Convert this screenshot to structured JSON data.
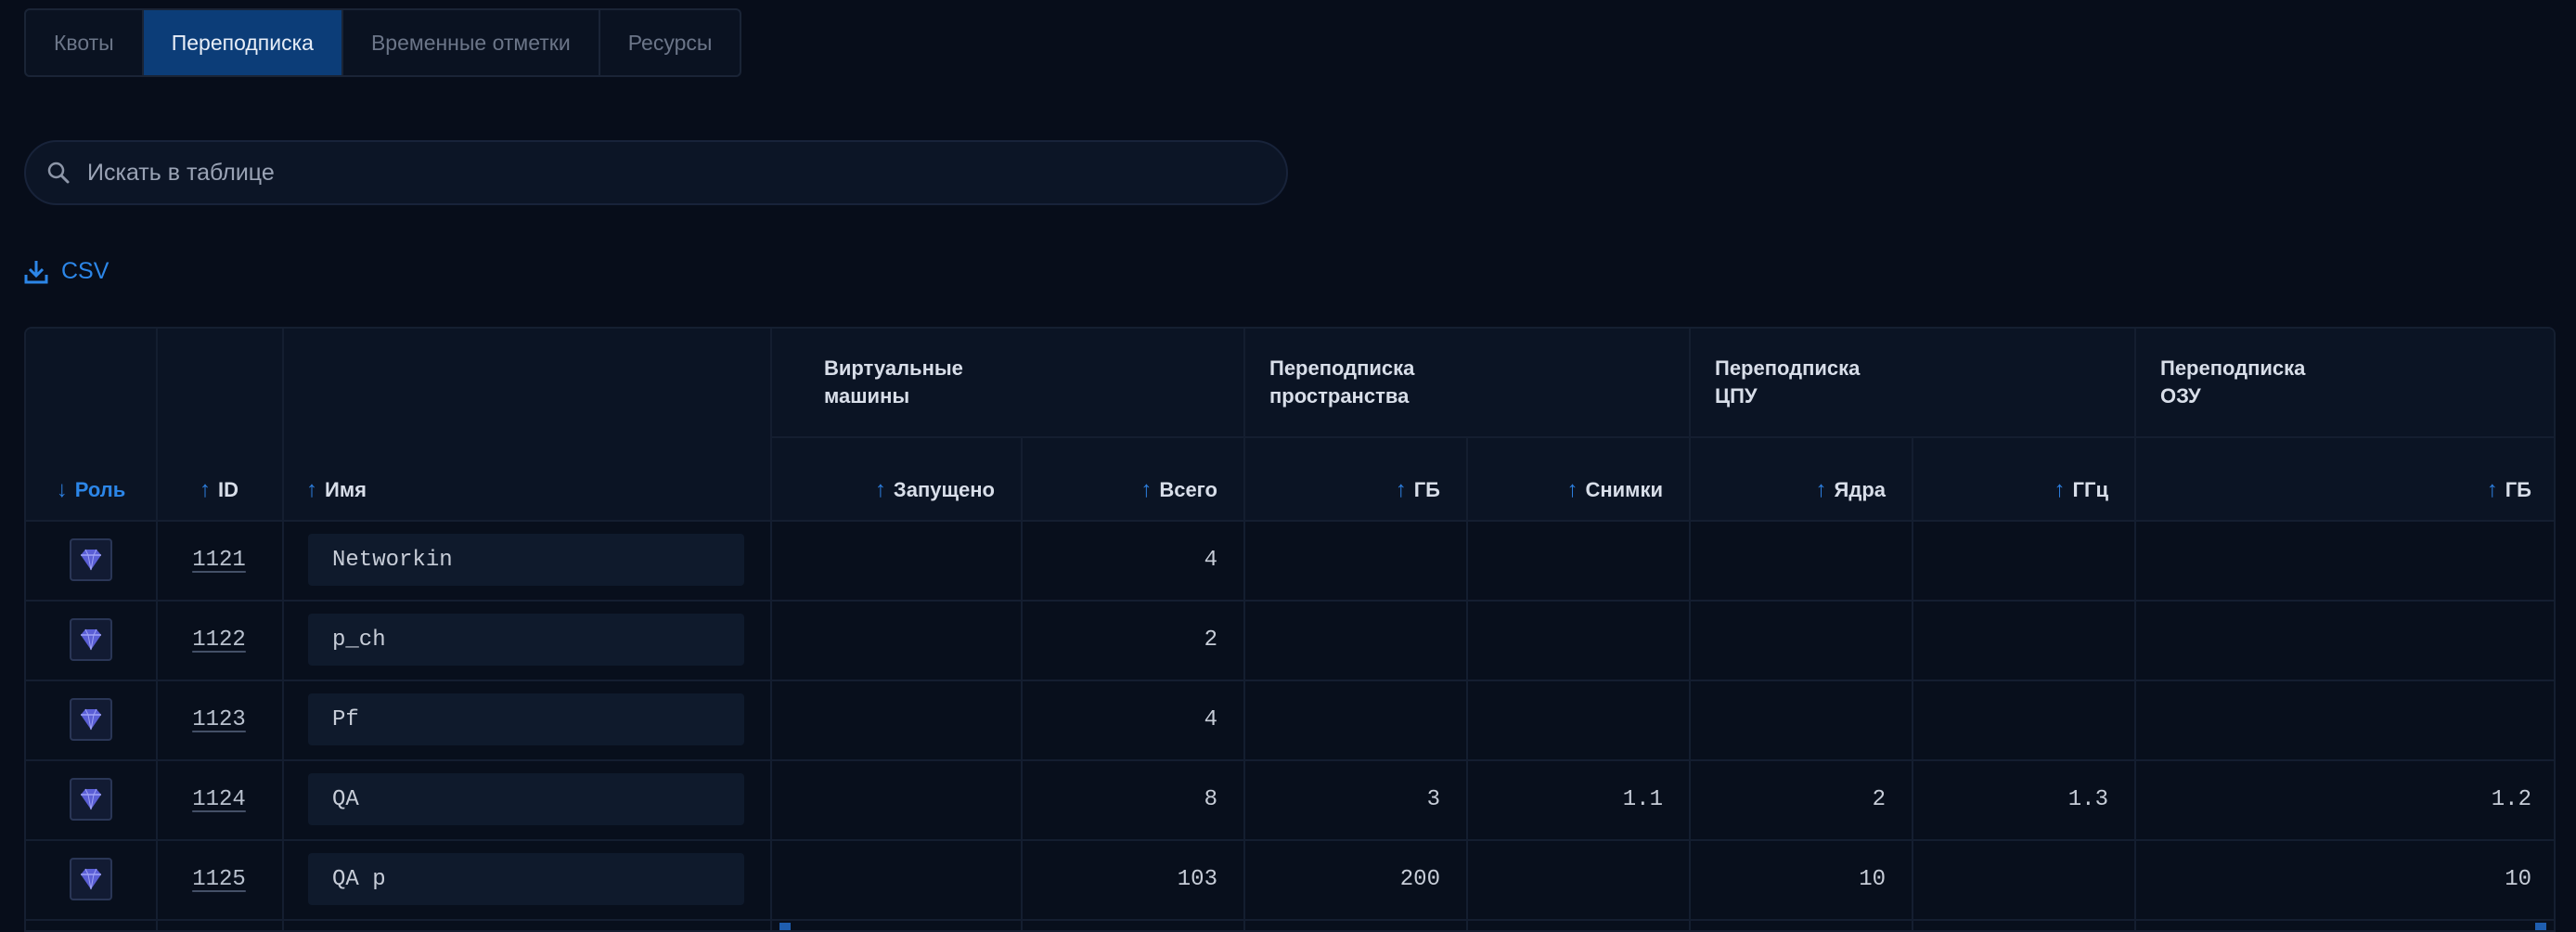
{
  "tabs": [
    {
      "label": "Квоты",
      "active": false
    },
    {
      "label": "Переподписка",
      "active": true
    },
    {
      "label": "Временные отметки",
      "active": false
    },
    {
      "label": "Ресурсы",
      "active": false
    }
  ],
  "search": {
    "placeholder": "Искать в таблице"
  },
  "csv_label": "CSV",
  "table": {
    "columns": {
      "role": "Роль",
      "id": "ID",
      "name": "Имя",
      "running": "Запущено",
      "total": "Всего",
      "space_gb": "ГБ",
      "snapshots": "Снимки",
      "cores": "Ядра",
      "ghz": "ГГц",
      "ram_gb": "ГБ"
    },
    "groups": {
      "vm": [
        "Виртуальные",
        "машины"
      ],
      "space": [
        "Переподписка",
        "пространства"
      ],
      "cpu": [
        "Переподписка",
        "ЦПУ"
      ],
      "ram": [
        "Переподписка",
        "ОЗУ"
      ]
    },
    "rows": [
      {
        "id": "1121",
        "name": "Networkin",
        "running": "",
        "total": "4",
        "space_gb": "",
        "snapshots": "",
        "cores": "",
        "ghz": "",
        "ram_gb": ""
      },
      {
        "id": "1122",
        "name": "p_ch",
        "running": "",
        "total": "2",
        "space_gb": "",
        "snapshots": "",
        "cores": "",
        "ghz": "",
        "ram_gb": ""
      },
      {
        "id": "1123",
        "name": "Pf",
        "running": "",
        "total": "4",
        "space_gb": "",
        "snapshots": "",
        "cores": "",
        "ghz": "",
        "ram_gb": ""
      },
      {
        "id": "1124",
        "name": "QA",
        "running": "",
        "total": "8",
        "space_gb": "3",
        "snapshots": "1.1",
        "cores": "2",
        "ghz": "1.3",
        "ram_gb": "1.2"
      },
      {
        "id": "1125",
        "name": "QA p",
        "running": "",
        "total": "103",
        "space_gb": "200",
        "snapshots": "",
        "cores": "10",
        "ghz": "",
        "ram_gb": "10"
      }
    ]
  },
  "colors": {
    "accent": "#2c86e8",
    "active_tab": "#0c3d78",
    "background": "#070d1a"
  },
  "icons": {
    "search": "search-icon",
    "download": "download-icon",
    "role": "diamond-role-icon",
    "sort": "sort-arrow-icon"
  }
}
